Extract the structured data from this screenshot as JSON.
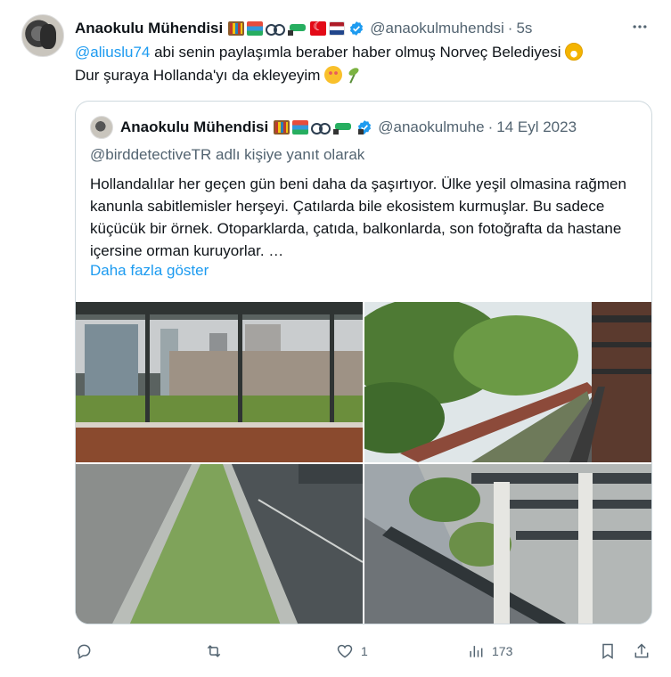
{
  "tweet": {
    "author_name": "Anaokulu Mühendisi",
    "handle": "@anaokulmuhendsi",
    "time": "5s",
    "mention": "@aliuslu74",
    "text_line1": " abi senin paylaşımla beraber haber olmuş Norveç Belediyesi ",
    "text_line2": "Dur şuraya Hollanda'yı da ekleyeyim "
  },
  "quote": {
    "author_name": "Anaokulu Mühendisi",
    "handle": "@anaokulmuhe",
    "time": "14 Eyl 2023",
    "reply_context": "@birddetectiveTR adlı kişiye yanıt olarak",
    "body": "Hollandalılar her geçen gün beni daha da şaşırtıyor. Ülke yeşil olmasina rağmen kanunla sabitlemisler herşeyi. Çatılarda bile ekosistem kurmuşlar. Bu sadece küçücük bir örnek. Otoparklarda, çatıda, balkonlarda, son fotoğrafta da hastane içersine orman kuruyorlar. …",
    "show_more": "Daha fazla göster"
  },
  "actions": {
    "reply_count": "",
    "retweet_count": "",
    "like_count": "1",
    "views_count": "173"
  },
  "icons": {
    "more": "more-horizontal-icon",
    "verified": "verified-badge-icon",
    "reply": "reply-icon",
    "retweet": "retweet-icon",
    "like": "heart-icon",
    "views": "analytics-icon",
    "bookmark": "bookmark-icon",
    "share": "share-icon"
  },
  "colors": {
    "link": "#1d9bf0",
    "secondary_text": "#536471",
    "verified": "#1d9bf0",
    "border": "#cfd9de"
  }
}
